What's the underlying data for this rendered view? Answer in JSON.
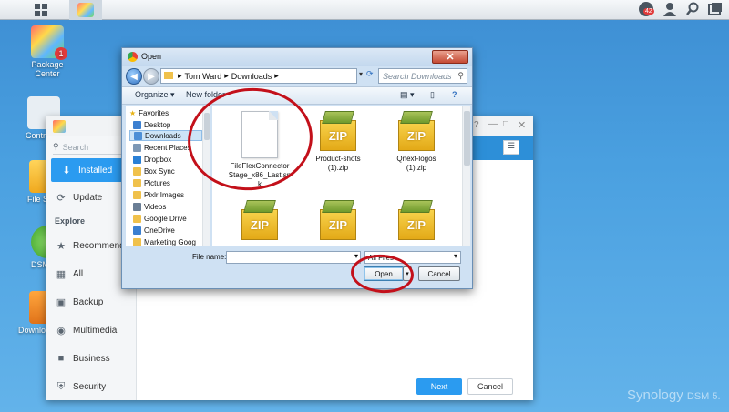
{
  "taskbar": {
    "notification_count": "42",
    "icons": [
      "main-menu-icon",
      "package-center-icon",
      "notification-icon",
      "user-icon",
      "search-icon",
      "widgets-icon"
    ]
  },
  "desktop": {
    "icons": [
      {
        "label": "Package\nCenter",
        "badge": "1"
      },
      {
        "label": "Contr",
        "badge": ""
      },
      {
        "label": "File S",
        "badge": ""
      },
      {
        "label": "DSM",
        "badge": ""
      },
      {
        "label": "Downlo",
        "badge": ""
      }
    ],
    "brand": "Synology",
    "brand_suffix": "DSM 5."
  },
  "package_center": {
    "search_placeholder": "Search",
    "installed_label": "Installed",
    "update_label": "Update",
    "explore_label": "Explore",
    "categories": [
      {
        "label": "Recommende",
        "icon": "star-icon"
      },
      {
        "label": "All",
        "icon": "grid-icon"
      },
      {
        "label": "Backup",
        "icon": "backup-icon"
      },
      {
        "label": "Multimedia",
        "icon": "multimedia-icon"
      },
      {
        "label": "Business",
        "icon": "business-icon"
      },
      {
        "label": "Security",
        "icon": "shield-icon"
      }
    ],
    "next_label": "Next",
    "cancel_label": "Cancel",
    "accent_color": "#2b9bf0"
  },
  "open_dialog": {
    "title": "Open",
    "path": [
      "Tom Ward",
      "Downloads"
    ],
    "search_placeholder": "Search Downloads",
    "organize_label": "Organize",
    "new_folder_label": "New folder",
    "favorites_label": "Favorites",
    "nav_items": [
      "Desktop",
      "Downloads",
      "Recent Places",
      "Dropbox",
      "Box Sync",
      "Pictures",
      "Pixlr Images",
      "Videos",
      "Google Drive",
      "OneDrive",
      "Marketing Goog"
    ],
    "files": [
      {
        "name": "FileFlexConnector\nStage_x86_Last.sp\nk",
        "type": "document"
      },
      {
        "name": "Product-shots\n(1).zip",
        "type": "zip"
      },
      {
        "name": "Qnext-logos\n(1).zip",
        "type": "zip"
      },
      {
        "name": "",
        "type": "zip"
      },
      {
        "name": "",
        "type": "zip"
      },
      {
        "name": "",
        "type": "zip"
      }
    ],
    "zip_text": "ZIP",
    "file_name_label": "File name:",
    "file_name_value": "",
    "filter_value": "All Files",
    "open_label": "Open",
    "cancel_label": "Cancel"
  }
}
